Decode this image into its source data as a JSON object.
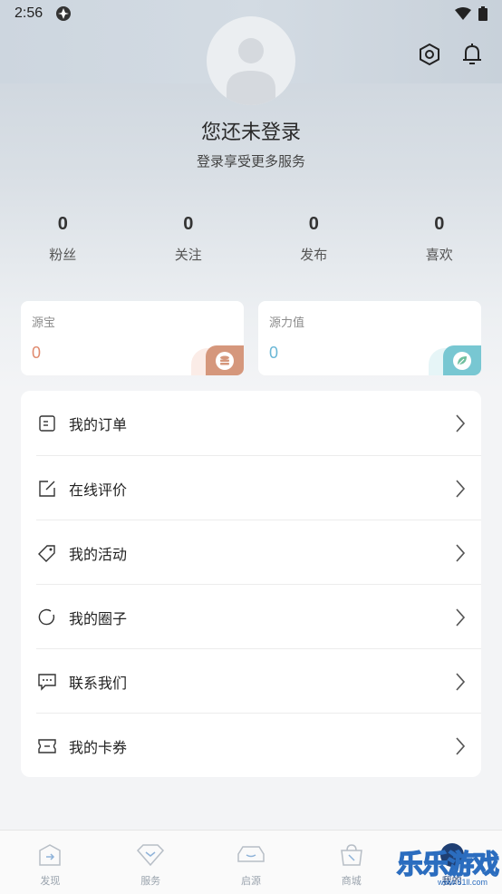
{
  "status_bar": {
    "time": "2:56"
  },
  "header": {
    "settings_icon": "hexagon-settings-icon",
    "bell_icon": "bell-icon"
  },
  "profile": {
    "title": "您还未登录",
    "subtitle": "登录享受更多服务"
  },
  "stats": [
    {
      "value": "0",
      "label": "粉丝"
    },
    {
      "value": "0",
      "label": "关注"
    },
    {
      "value": "0",
      "label": "发布"
    },
    {
      "value": "0",
      "label": "喜欢"
    }
  ],
  "cards": [
    {
      "label": "源宝",
      "value": "0",
      "value_color": "#e08a6e",
      "badge_color": "#d5977c"
    },
    {
      "label": "源力值",
      "value": "0",
      "value_color": "#6ab7d6",
      "badge_color": "#78c7d2"
    }
  ],
  "menu": [
    {
      "label": "我的订单",
      "icon": "order-icon"
    },
    {
      "label": "在线评价",
      "icon": "edit-icon"
    },
    {
      "label": "我的活动",
      "icon": "tag-icon"
    },
    {
      "label": "我的圈子",
      "icon": "circle-icon"
    },
    {
      "label": "联系我们",
      "icon": "chat-icon"
    },
    {
      "label": "我的卡券",
      "icon": "ticket-icon"
    }
  ],
  "bottom_nav": [
    {
      "label": "发现",
      "icon": "discover-icon"
    },
    {
      "label": "服务",
      "icon": "service-icon"
    },
    {
      "label": "启源",
      "icon": "car-icon"
    },
    {
      "label": "商城",
      "icon": "shop-icon"
    },
    {
      "label": "我的",
      "icon": "profile-icon",
      "active": true
    }
  ],
  "watermark": {
    "text": "乐乐游戏",
    "url": "www.61ll.com"
  },
  "colors": {
    "accent": "#1f3f73",
    "background": "#f3f4f6"
  }
}
